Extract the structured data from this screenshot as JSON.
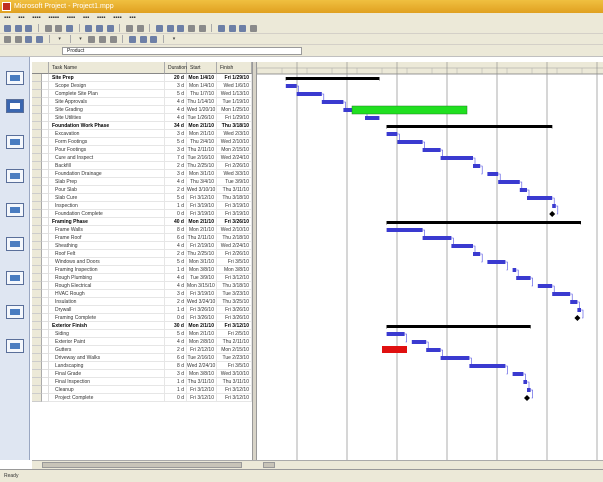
{
  "window": {
    "title": "Microsoft Project - Project1.mpp"
  },
  "entry_bar": {
    "value": "Product"
  },
  "table": {
    "columns": [
      "Task Name",
      "Duration",
      "Start",
      "Finish"
    ],
    "rows": [
      {
        "name": "Site Prep",
        "dur": "20 d",
        "start": "Mon 1/4/10",
        "fin": "Fri 1/29/10",
        "summary": true
      },
      {
        "name": "Scope Design",
        "dur": "3 d",
        "start": "Mon 1/4/10",
        "fin": "Wed 1/6/10"
      },
      {
        "name": "Complete Site Plan",
        "dur": "5 d",
        "start": "Thu 1/7/10",
        "fin": "Wed 1/13/10"
      },
      {
        "name": "Site Approvals",
        "dur": "4 d",
        "start": "Thu 1/14/10",
        "fin": "Tue 1/19/10"
      },
      {
        "name": "Site Grading",
        "dur": "4 d",
        "start": "Wed 1/20/10",
        "fin": "Mon 1/25/10"
      },
      {
        "name": "Site Utilities",
        "dur": "4 d",
        "start": "Tue 1/26/10",
        "fin": "Fri 1/29/10"
      },
      {
        "name": "Foundation Work Phase",
        "dur": "34 d",
        "start": "Mon 2/1/10",
        "fin": "Thu 3/18/10",
        "summary": true
      },
      {
        "name": "Excavation",
        "dur": "3 d",
        "start": "Mon 2/1/10",
        "fin": "Wed 2/3/10"
      },
      {
        "name": "Form Footings",
        "dur": "5 d",
        "start": "Thu 2/4/10",
        "fin": "Wed 2/10/10"
      },
      {
        "name": "Pour Footings",
        "dur": "3 d",
        "start": "Thu 2/11/10",
        "fin": "Mon 2/15/10"
      },
      {
        "name": "Cure and Inspect",
        "dur": "7 d",
        "start": "Tue 2/16/10",
        "fin": "Wed 2/24/10"
      },
      {
        "name": "Backfill",
        "dur": "2 d",
        "start": "Thu 2/25/10",
        "fin": "Fri 2/26/10"
      },
      {
        "name": "Foundation Drainage",
        "dur": "3 d",
        "start": "Mon 3/1/10",
        "fin": "Wed 3/3/10"
      },
      {
        "name": "Slab Prep",
        "dur": "4 d",
        "start": "Thu 3/4/10",
        "fin": "Tue 3/9/10"
      },
      {
        "name": "Pour Slab",
        "dur": "2 d",
        "start": "Wed 3/10/10",
        "fin": "Thu 3/11/10"
      },
      {
        "name": "Slab Cure",
        "dur": "5 d",
        "start": "Fri 3/12/10",
        "fin": "Thu 3/18/10"
      },
      {
        "name": "Inspection",
        "dur": "1 d",
        "start": "Fri 3/19/10",
        "fin": "Fri 3/19/10"
      },
      {
        "name": "Foundation Complete",
        "dur": "0 d",
        "start": "Fri 3/19/10",
        "fin": "Fri 3/19/10"
      },
      {
        "name": "Framing Phase",
        "dur": "40 d",
        "start": "Mon 2/1/10",
        "fin": "Fri 3/26/10",
        "summary": true
      },
      {
        "name": "Frame Walls",
        "dur": "8 d",
        "start": "Mon 2/1/10",
        "fin": "Wed 2/10/10"
      },
      {
        "name": "Frame Roof",
        "dur": "6 d",
        "start": "Thu 2/11/10",
        "fin": "Thu 2/18/10"
      },
      {
        "name": "Sheathing",
        "dur": "4 d",
        "start": "Fri 2/19/10",
        "fin": "Wed 2/24/10"
      },
      {
        "name": "Roof Felt",
        "dur": "2 d",
        "start": "Thu 2/25/10",
        "fin": "Fri 2/26/10"
      },
      {
        "name": "Windows and Doors",
        "dur": "5 d",
        "start": "Mon 3/1/10",
        "fin": "Fri 3/5/10"
      },
      {
        "name": "Framing Inspection",
        "dur": "1 d",
        "start": "Mon 3/8/10",
        "fin": "Mon 3/8/10"
      },
      {
        "name": "Rough Plumbing",
        "dur": "4 d",
        "start": "Tue 3/9/10",
        "fin": "Fri 3/12/10"
      },
      {
        "name": "Rough Electrical",
        "dur": "4 d",
        "start": "Mon 3/15/10",
        "fin": "Thu 3/18/10"
      },
      {
        "name": "HVAC Rough",
        "dur": "3 d",
        "start": "Fri 3/19/10",
        "fin": "Tue 3/23/10"
      },
      {
        "name": "Insulation",
        "dur": "2 d",
        "start": "Wed 3/24/10",
        "fin": "Thu 3/25/10"
      },
      {
        "name": "Drywall",
        "dur": "1 d",
        "start": "Fri 3/26/10",
        "fin": "Fri 3/26/10"
      },
      {
        "name": "Framing Complete",
        "dur": "0 d",
        "start": "Fri 3/26/10",
        "fin": "Fri 3/26/10"
      },
      {
        "name": "Exterior Finish",
        "dur": "30 d",
        "start": "Mon 2/1/10",
        "fin": "Fri 3/12/10",
        "summary": true
      },
      {
        "name": "Siding",
        "dur": "5 d",
        "start": "Mon 2/1/10",
        "fin": "Fri 2/5/10"
      },
      {
        "name": "Exterior Paint",
        "dur": "4 d",
        "start": "Mon 2/8/10",
        "fin": "Thu 2/11/10"
      },
      {
        "name": "Gutters",
        "dur": "2 d",
        "start": "Fri 2/12/10",
        "fin": "Mon 2/15/10"
      },
      {
        "name": "Driveway and Walks",
        "dur": "6 d",
        "start": "Tue 2/16/10",
        "fin": "Tue 2/23/10"
      },
      {
        "name": "Landscaping",
        "dur": "8 d",
        "start": "Wed 2/24/10",
        "fin": "Fri 3/5/10"
      },
      {
        "name": "Final Grade",
        "dur": "3 d",
        "start": "Mon 3/8/10",
        "fin": "Wed 3/10/10"
      },
      {
        "name": "Final Inspection",
        "dur": "1 d",
        "start": "Thu 3/11/10",
        "fin": "Thu 3/11/10"
      },
      {
        "name": "Cleanup",
        "dur": "1 d",
        "start": "Fri 3/12/10",
        "fin": "Fri 3/12/10"
      },
      {
        "name": "Project Complete",
        "dur": "0 d",
        "start": "Fri 3/12/10",
        "fin": "Fri 3/12/10"
      }
    ]
  },
  "status": {
    "text": "Ready"
  },
  "colors": {
    "task_bar": "#3a3ad0",
    "summary_bar": "#000000",
    "highlight_green": "#20e020",
    "highlight_red": "#e01010",
    "link_line": "#4a4ae0"
  }
}
